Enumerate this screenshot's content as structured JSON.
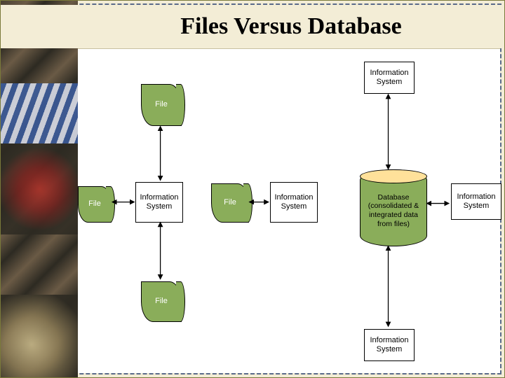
{
  "title": "Files Versus Database",
  "left": {
    "file_top": "File",
    "file_left": "File",
    "file_right": "File",
    "file_bottom": "File",
    "info_sys_center": "Information System",
    "info_sys_right": "Information System"
  },
  "right": {
    "info_sys_top": "Information System",
    "info_sys_right": "Information System",
    "info_sys_bottom": "Information System",
    "database": "Database (consolidated & integrated data from files)"
  },
  "chart_data": {
    "type": "diagram",
    "title": "Files Versus Database",
    "sections": [
      {
        "name": "file-based-approach",
        "nodes": [
          {
            "id": "file-top",
            "type": "file",
            "label": "File"
          },
          {
            "id": "file-left",
            "type": "file",
            "label": "File"
          },
          {
            "id": "file-right",
            "type": "file",
            "label": "File"
          },
          {
            "id": "file-bottom",
            "type": "file",
            "label": "File"
          },
          {
            "id": "is-center",
            "type": "information-system",
            "label": "Information System"
          },
          {
            "id": "is-right",
            "type": "information-system",
            "label": "Information System"
          }
        ],
        "edges": [
          {
            "from": "file-top",
            "to": "is-center",
            "bidirectional": true
          },
          {
            "from": "file-left",
            "to": "is-center",
            "bidirectional": true
          },
          {
            "from": "file-bottom",
            "to": "is-center",
            "bidirectional": true
          },
          {
            "from": "file-right",
            "to": "is-right",
            "bidirectional": true
          }
        ]
      },
      {
        "name": "database-approach",
        "nodes": [
          {
            "id": "db",
            "type": "database",
            "label": "Database (consolidated & integrated data from files)"
          },
          {
            "id": "is-top",
            "type": "information-system",
            "label": "Information System"
          },
          {
            "id": "is-right2",
            "type": "information-system",
            "label": "Information System"
          },
          {
            "id": "is-bottom",
            "type": "information-system",
            "label": "Information System"
          }
        ],
        "edges": [
          {
            "from": "is-top",
            "to": "db",
            "bidirectional": true
          },
          {
            "from": "is-right2",
            "to": "db",
            "bidirectional": true
          },
          {
            "from": "is-bottom",
            "to": "db",
            "bidirectional": true
          }
        ]
      }
    ]
  }
}
